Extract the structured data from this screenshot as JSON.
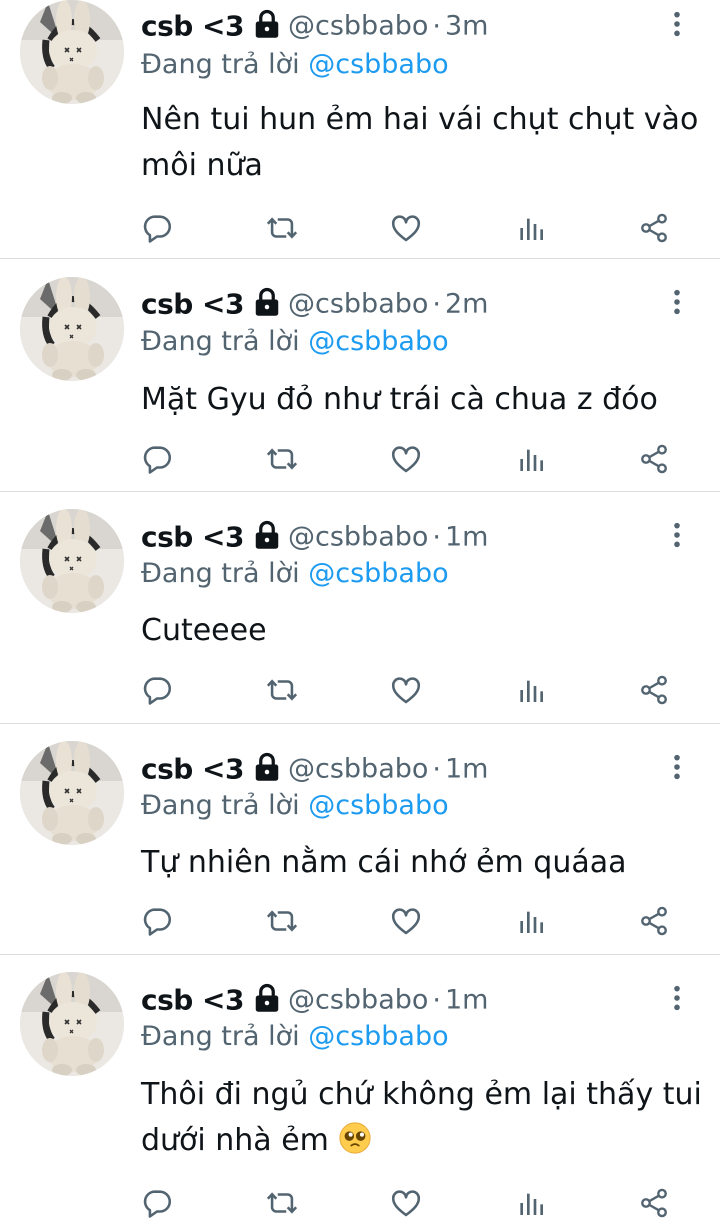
{
  "colors": {
    "text_primary": "#0f1419",
    "text_secondary": "#536471",
    "mention": "#1d9bf0",
    "divider": "#dcdfe2",
    "icon": "#536471"
  },
  "icons": {
    "lock": "lock-icon",
    "more": "more-vertical-icon",
    "reply": "reply-icon",
    "retweet": "retweet-icon",
    "like": "heart-icon",
    "views": "views-icon",
    "share": "share-icon",
    "emoji": "pleading-face-emoji"
  },
  "tweets": [
    {
      "display_name": "csb <3",
      "handle": "@csbbabo",
      "separator": "·",
      "time": "3m",
      "replying_prefix": "Đang trả lời",
      "replying_to": "@csbbabo",
      "text": "Nên tui hun ẻm hai vái chụt chụt vào môi nữa"
    },
    {
      "display_name": "csb <3",
      "handle": "@csbbabo",
      "separator": "·",
      "time": "2m",
      "replying_prefix": "Đang trả lời",
      "replying_to": "@csbbabo",
      "text": "Mặt Gyu đỏ như trái cà chua z đóo"
    },
    {
      "display_name": "csb <3",
      "handle": "@csbbabo",
      "separator": "·",
      "time": "1m",
      "replying_prefix": "Đang trả lời",
      "replying_to": "@csbbabo",
      "text": "Cuteeee"
    },
    {
      "display_name": "csb <3",
      "handle": "@csbbabo",
      "separator": "·",
      "time": "1m",
      "replying_prefix": "Đang trả lời",
      "replying_to": "@csbbabo",
      "text": "Tự nhiên nằm cái nhớ ẻm quáaa"
    },
    {
      "display_name": "csb <3",
      "handle": "@csbbabo",
      "separator": "·",
      "time": "1m",
      "replying_prefix": "Đang trả lời",
      "replying_to": "@csbbabo",
      "text": "Thôi đi ngủ chứ không ẻm lại thấy tui dưới nhà ẻm"
    }
  ]
}
